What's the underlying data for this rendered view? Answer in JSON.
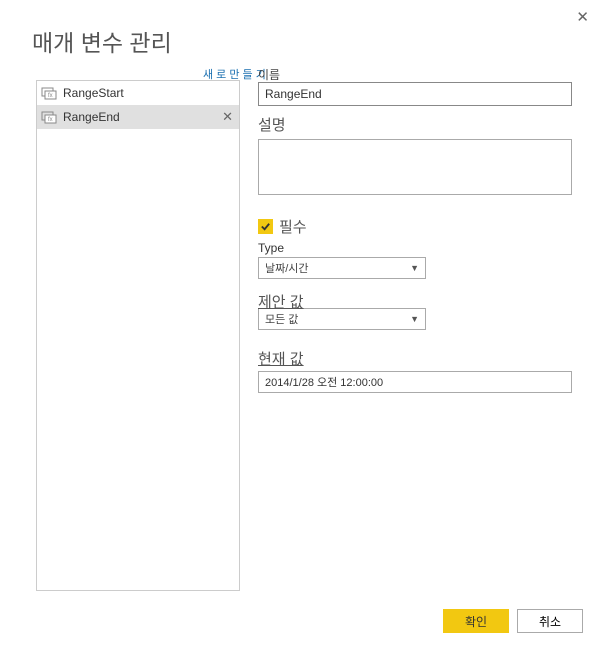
{
  "dialog": {
    "title": "매개 변수 관리",
    "close": "✕",
    "newLink": "새 로 만 들 기",
    "nameLabel": "이름"
  },
  "params": {
    "items": [
      {
        "name": "RangeStart"
      },
      {
        "name": "RangeEnd"
      }
    ]
  },
  "form": {
    "nameValue": "RangeEnd",
    "descLabel": "설명",
    "descValue": "",
    "requiredLabel": "필수",
    "requiredChecked": true,
    "typeLabel": "Type",
    "typeValue": "날짜/시간",
    "suggestLabel": "제안 값",
    "suggestValue": "모든 값",
    "currentLabel": "현재 값",
    "currentValue": "2014/1/28 오전 12:00:00"
  },
  "buttons": {
    "ok": "확인",
    "cancel": "취소"
  }
}
